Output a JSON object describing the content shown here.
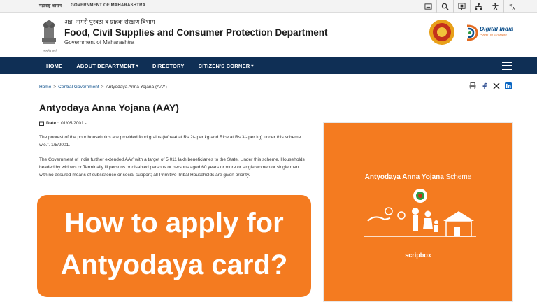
{
  "topbar": {
    "marathi_label": "महाराष्ट्र शासन",
    "gov_label": "GOVERNMENT OF MAHARASHTRA",
    "tools": [
      "sitemap-icon",
      "search-icon",
      "screen-reader-icon",
      "hierarchy-icon",
      "accessibility-icon",
      "language-icon"
    ]
  },
  "header": {
    "hindi_name": "अन्न, नागरी पुरवठा व ग्राहक संरक्षण विभाग",
    "dept_name": "Food, Civil Supplies and Consumer Protection Department",
    "gov_name": "Government of Maharashtra",
    "emblem_caption": "सत्यमेव जयते",
    "digital_india": "Digital India",
    "digital_india_tagline": "Power To Empower"
  },
  "nav": {
    "items": [
      {
        "label": "HOME",
        "dropdown": false
      },
      {
        "label": "ABOUT DEPARTMENT",
        "dropdown": true
      },
      {
        "label": "DIRECTORY",
        "dropdown": false
      },
      {
        "label": "CITIZEN'S CORNER",
        "dropdown": true
      }
    ]
  },
  "breadcrumb": {
    "home": "Home",
    "sep1": ">",
    "central": "Central Government",
    "sep2": ">",
    "current": "Antyodaya Anna Yojana (AAY)"
  },
  "page": {
    "title": "Antyodaya Anna Yojana (AAY)",
    "date_label": "Date :",
    "date_value": "01/05/2001 -",
    "para1": "The poorest of the poor households are provided food grains (Wheat at Rs.2/- per kg and Rice at Rs.3/- per kg) under this scheme w.e.f. 1/5/2001.",
    "para2": "The Government of India further extended AAY with a target of 5.011 lakh beneficiaries to the State, Under this scheme, Households headed by widows or Terminally ill persons or disabled persons or persons aged 60 years or more or single women or single men with no assured means of subsistence or social support; all Primitive Tribal Households are given priority."
  },
  "card": {
    "title_bold": "Antyodaya Anna Yojana",
    "title_rest": "Scheme",
    "brand": "scripbox"
  },
  "banner": {
    "line1": "How to apply for",
    "line2": "Antyodaya card?"
  },
  "colors": {
    "nav_bg": "#0f2f55",
    "accent_orange": "#f47b20",
    "link_blue": "#0b4e8a"
  }
}
